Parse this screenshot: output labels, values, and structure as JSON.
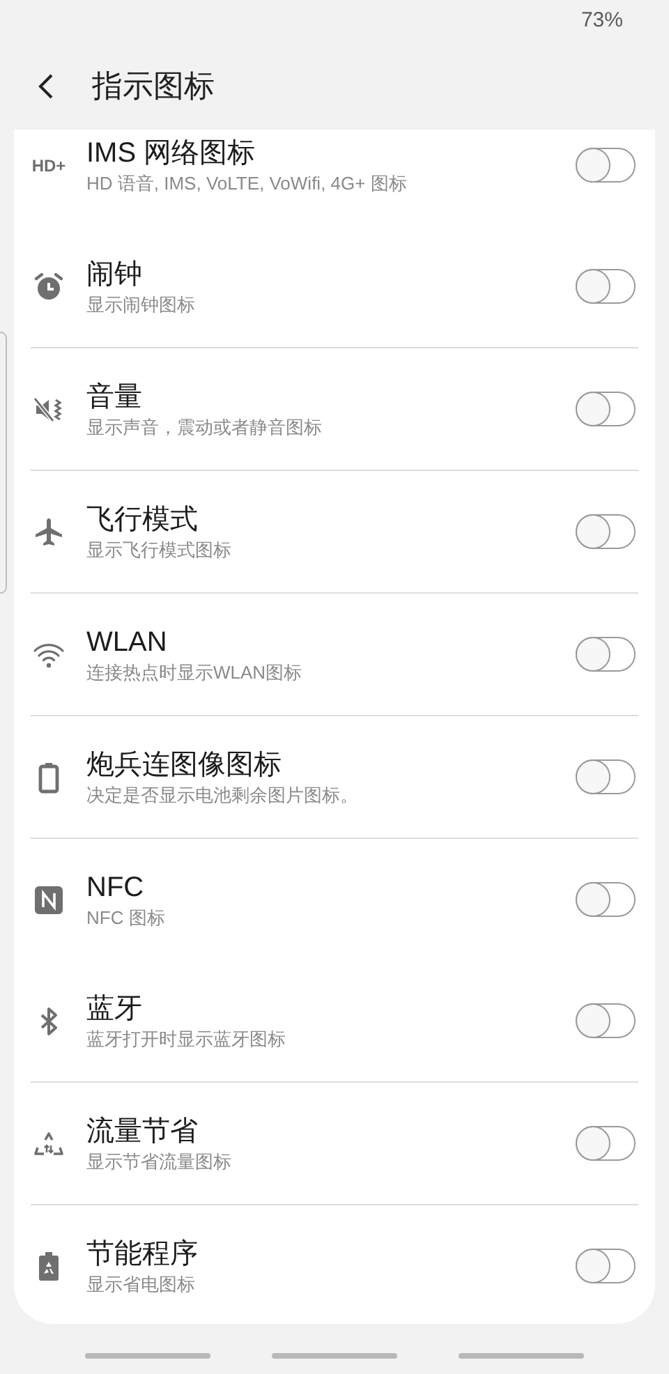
{
  "status_bar": {
    "battery": "73%"
  },
  "header": {
    "title": "指示图标"
  },
  "groups": [
    {
      "items": [
        {
          "icon_text": "HD+",
          "title": "IMS 网络图标",
          "subtitle": "HD 语音, IMS, VoLTE, VoWifi, 4G+ 图标",
          "on": false
        },
        {
          "title": "闹钟",
          "subtitle": "显示闹钟图标",
          "on": false
        }
      ]
    },
    {
      "items": [
        {
          "title": "音量",
          "subtitle": "显示声音，震动或者静音图标",
          "on": false
        }
      ]
    },
    {
      "items": [
        {
          "title": "飞行模式",
          "subtitle": "显示飞行模式图标",
          "on": false
        }
      ]
    },
    {
      "items": [
        {
          "title": "WLAN",
          "subtitle": "连接热点时显示WLAN图标",
          "on": false
        }
      ]
    },
    {
      "items": [
        {
          "title": "炮兵连图像图标",
          "subtitle": "决定是否显示电池剩余图片图标。",
          "on": false
        }
      ]
    },
    {
      "items": [
        {
          "title": "NFC",
          "subtitle": "NFC 图标",
          "on": false
        },
        {
          "title": "蓝牙",
          "subtitle": "蓝牙打开时显示蓝牙图标",
          "on": false
        }
      ]
    },
    {
      "items": [
        {
          "title": "流量节省",
          "subtitle": "显示节省流量图标",
          "on": false
        }
      ]
    },
    {
      "items": [
        {
          "title": "节能程序",
          "subtitle": "显示省电图标",
          "on": false
        }
      ]
    }
  ]
}
